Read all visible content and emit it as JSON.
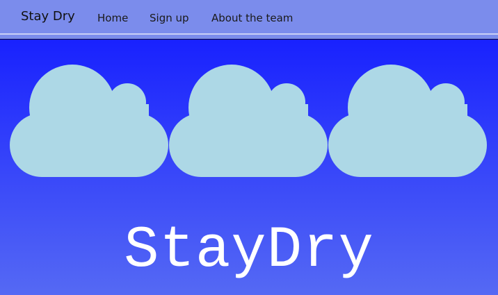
{
  "nav": {
    "brand": "Stay Dry",
    "links": [
      {
        "label": "Home"
      },
      {
        "label": "Sign up"
      },
      {
        "label": "About the team"
      }
    ]
  },
  "hero": {
    "title": "StayDry"
  },
  "clouds": [
    {
      "icon": "cloud-icon"
    },
    {
      "icon": "cloud-icon"
    },
    {
      "icon": "cloud-icon"
    }
  ],
  "colors": {
    "nav_background": "#7b8cec",
    "background_top": "#0f16ff",
    "background_bottom": "#5569f4",
    "cloud": "#add8e6",
    "title": "#ffffff"
  }
}
